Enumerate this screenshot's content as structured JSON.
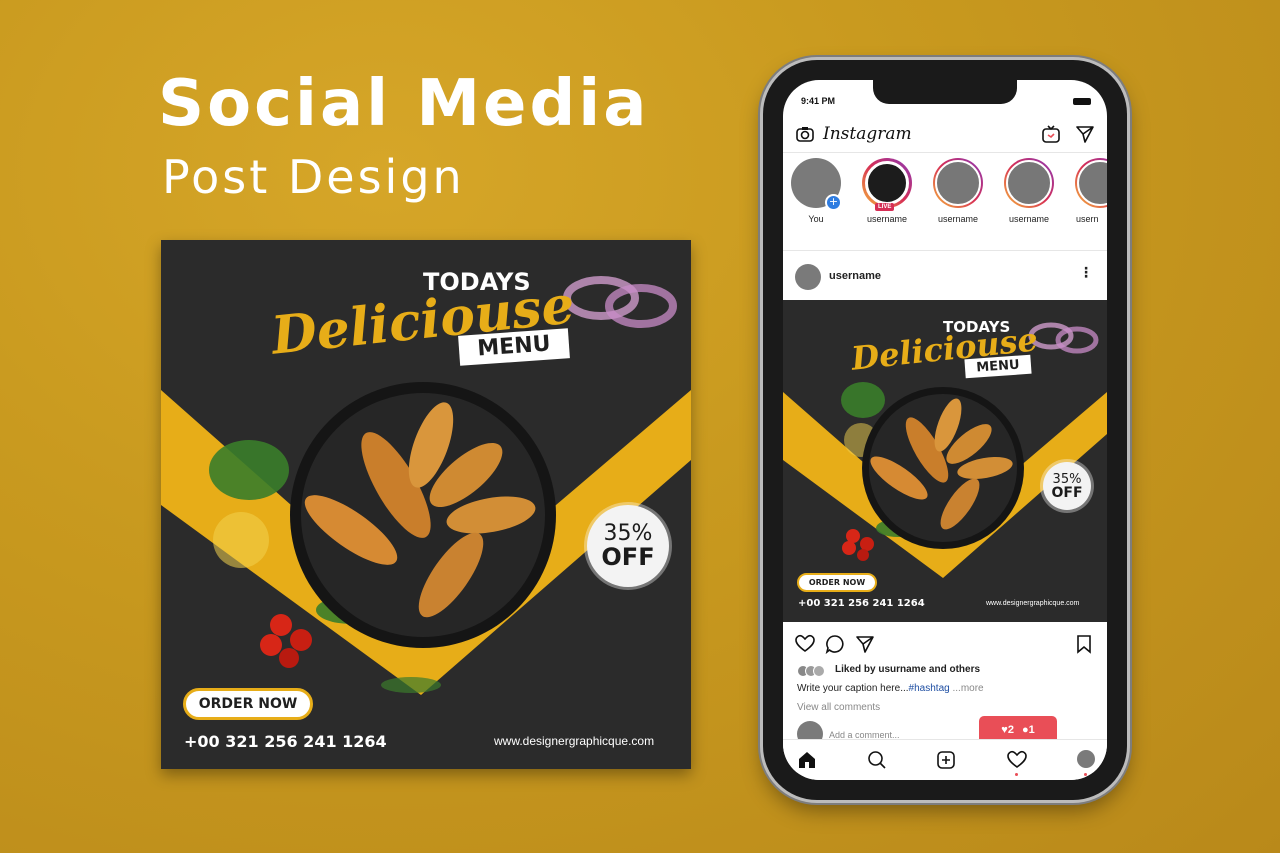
{
  "headline": {
    "title": "Social Media",
    "subtitle": "Post Design"
  },
  "post": {
    "kicker": "TODAYS",
    "script_title": "Deliciouse",
    "menu_label": "MENU",
    "discount_percent": "35%",
    "discount_label": "OFF",
    "order_button": "ORDER NOW",
    "phone": "+00 321 256 241 1264",
    "website": "www.designergraphicque.com"
  },
  "phone": {
    "status_time": "9:41 PM",
    "app_name": "Instagram",
    "stories": [
      {
        "name": "You"
      },
      {
        "name": "username",
        "badge": "LIVE"
      },
      {
        "name": "username"
      },
      {
        "name": "username"
      },
      {
        "name": "usern"
      }
    ],
    "post_username": "username",
    "more_glyph": "⋮",
    "liked_by": "Liked by usurname and others",
    "caption_text": "Write your caption here...",
    "caption_tag": "#hashtag",
    "caption_more": " ...more",
    "view_comments": "View all comments",
    "add_comment_placeholder": "Add a comment...",
    "notifications": {
      "likes": "2",
      "comments": "1"
    }
  },
  "colors": {
    "background": "#c99a1f",
    "accent_yellow": "#e7ad18",
    "post_dark": "#2a2a2a",
    "notification_red": "#e94e57"
  },
  "icons": [
    "camera-icon",
    "igtv-icon",
    "send-icon",
    "heart-icon",
    "comment-icon",
    "share-icon",
    "bookmark-icon",
    "home-icon",
    "search-icon",
    "add-icon",
    "activity-icon",
    "profile-icon"
  ]
}
